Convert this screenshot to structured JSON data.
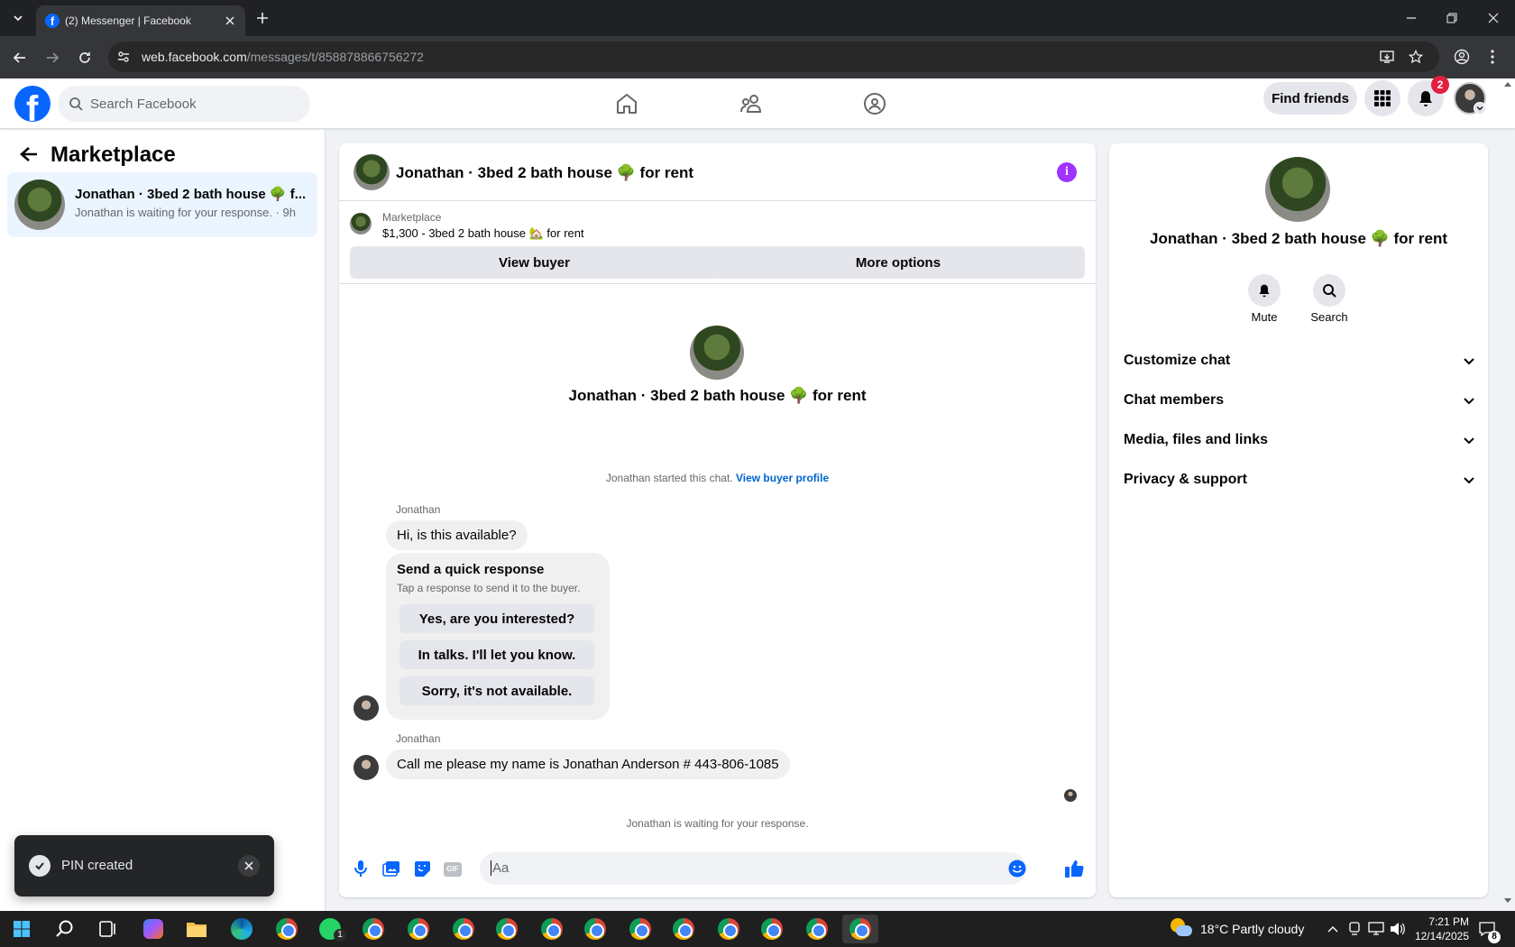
{
  "browser": {
    "tab_title": "(2) Messenger | Facebook",
    "url_host": "web.facebook.com",
    "url_path": "/messages/t/858878866756272"
  },
  "fb": {
    "search_placeholder": "Search Facebook",
    "find_friends": "Find friends",
    "notif_count": "2",
    "brand_color": "#0866ff"
  },
  "left": {
    "title": "Marketplace",
    "thread": {
      "title": "Jonathan · 3bed 2 bath house 🌳 f...",
      "preview": "Jonathan is waiting for your response. · 9h"
    }
  },
  "chat": {
    "header_title": "Jonathan · 3bed 2 bath house 🌳 for rent",
    "listing_label": "Marketplace",
    "listing_text": "$1,300 - 3bed 2 bath house 🏡 for rent",
    "view_buyer": "View buyer",
    "more_options": "More options",
    "intro_title": "Jonathan · 3bed 2 bath house 🌳 for rent",
    "started_text": "Jonathan started this chat.",
    "view_buyer_profile": "View buyer profile",
    "sender1": "Jonathan",
    "msg1": "Hi, is this available?",
    "quick_title": "Send a quick response",
    "quick_sub": "Tap a response to send it to the buyer.",
    "quick_responses": [
      "Yes, are you interested?",
      "In talks. I'll let you know.",
      "Sorry, it's not available."
    ],
    "sender2": "Jonathan",
    "msg2": "Call me  please my name is Jonathan Anderson # 443-806-1085",
    "waiting_text": "Jonathan is waiting for your response.",
    "composer_placeholder": "Aa",
    "gif_label": "GIF"
  },
  "right": {
    "title": "Jonathan · 3bed 2 bath house 🌳 for rent",
    "mute": "Mute",
    "search": "Search",
    "sections": [
      "Customize chat",
      "Chat members",
      "Media, files and links",
      "Privacy & support"
    ]
  },
  "toast": {
    "text": "PIN created"
  },
  "taskbar": {
    "weather": "18°C  Partly cloudy",
    "time": "7:21 PM",
    "date": "12/14/2025",
    "whatsapp_badge": "1",
    "notif_badge": "8"
  }
}
